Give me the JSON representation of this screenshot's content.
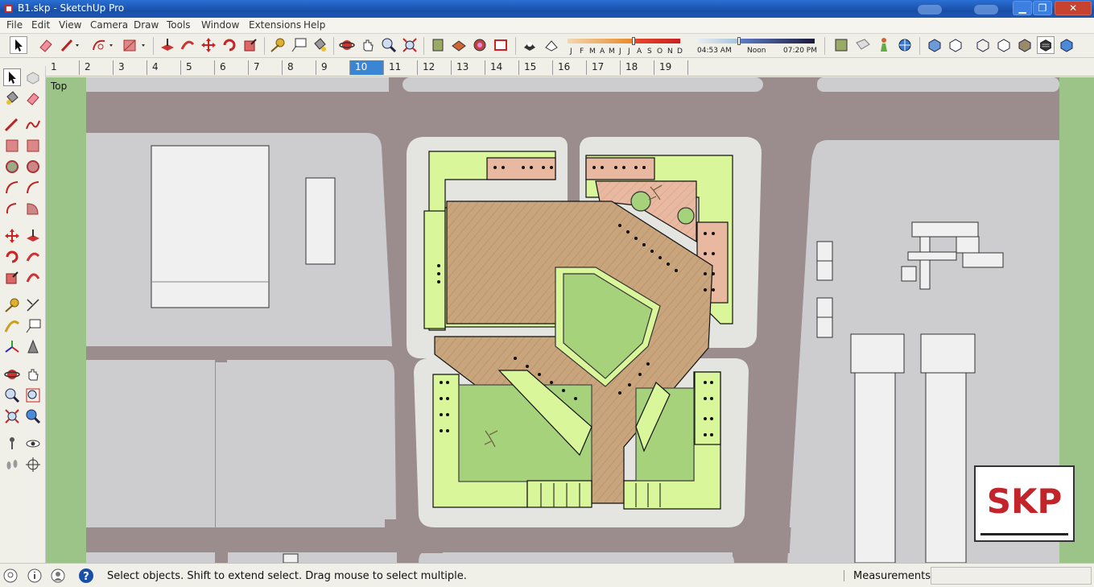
{
  "window": {
    "title": "B1.skp - SketchUp Pro",
    "minimize": "▁",
    "maximize": "❐",
    "close": "✕"
  },
  "menu": [
    "File",
    "Edit",
    "View",
    "Camera",
    "Draw",
    "Tools",
    "Window",
    "Extensions",
    "Help"
  ],
  "shadows": {
    "months": [
      "J",
      "F",
      "M",
      "A",
      "M",
      "J",
      "J",
      "A",
      "S",
      "O",
      "N",
      "D"
    ],
    "time_start": "04:53 AM",
    "time_mid": "Noon",
    "time_end": "07:20 PM"
  },
  "scenes": {
    "tabs": [
      "1",
      "2",
      "3",
      "4",
      "5",
      "6",
      "7",
      "8",
      "9",
      "10",
      "11",
      "12",
      "13",
      "14",
      "15",
      "16",
      "17",
      "18",
      "19"
    ],
    "active": "10"
  },
  "viewport": {
    "view_label": "Top",
    "logo_text": "SKP"
  },
  "status": {
    "message": "Select objects. Shift to extend select. Drag mouse to select multiple.",
    "measurements_label": "Measurements",
    "measurements_value": ""
  },
  "colors": {
    "road": "#9b8c8d",
    "sidewalk": "#e4e4e0",
    "ground": "#cdcccf",
    "lawn": "#a6d27c",
    "building": "#d9f79a",
    "deck": "#c9a57d",
    "plaza": "#e8b8a0",
    "edge_green": "#9cc488",
    "accent_blue": "#3a86d4",
    "logo_red": "#c2242a"
  }
}
